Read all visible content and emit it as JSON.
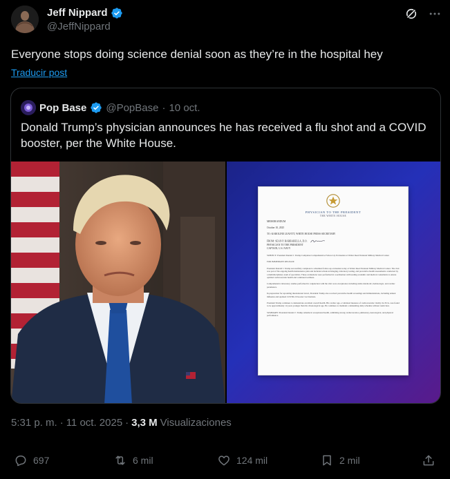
{
  "author": {
    "name": "Jeff Nippard",
    "handle": "@JeffNippard"
  },
  "tweet": {
    "text": "Everyone stops doing science denial soon as they’re in the hospital hey",
    "translate_label": "Traducir post"
  },
  "quoted": {
    "name": "Pop Base",
    "handle": "@PopBase",
    "separator": "·",
    "date": "10 oct.",
    "text": "Donald Trump’s physician announces he has received a flu shot and a COVID booster, per the White House.",
    "document": {
      "title": "PHYSICIAN TO THE PRESIDENT",
      "subtitle": "THE WHITE HOUSE",
      "memo": "MEMORANDUM",
      "date": "October 10, 2025",
      "to": "TO: KAROLINE LEAVITT, WHITE HOUSE PRESS SECRETARY",
      "from_1": "FROM: SEAN P. BARBABELLA, D.O.",
      "from_2": "PHYSICIAN TO THE PRESIDENT",
      "from_3": "CAPTAIN, U.S. NAVY",
      "subject": "SUBJECT: President Donald J. Trump Completes Comprehensive Follow-Up Evaluation at Walter Reed National Military Medical Center",
      "release": "FOR IMMEDIATE RELEASE",
      "para_1": "President Donald J. Trump successfully completed a scheduled follow-up evaluation today at Walter Reed National Military Medical Center. The visit was part of his ongoing health maintenance plan and included advanced imaging, laboratory testing, and preventive health assessments conducted by a multidisciplinary team of specialists. These evaluations were performed in coordination with leading academic and medical consultants to ensure optimal cardiovascular health and continued wellness.",
      "para_2": "Comprehensive laboratory studies performed in conjunction with the visit were exceptional, including stable metabolic, hematologic, and cardiac parameters.",
      "para_3": "In preparation for upcoming international travel, President Trump also received preventive health screenings and immunizations, including annual influenza and updated COVID-19 booster vaccinations.",
      "para_4": "President Trump continues to demonstrate excellent overall health. His cardiac age–a validated measure of cardiovascular vitality via ECG–was found to be approximately 14 years younger than his chronological age. He continues to maintain a demanding daily schedule without restriction.",
      "summary": "SUMMARY: President Donald J. Trump remains in exceptional health, exhibiting strong cardiovascular, pulmonary, neurological, and physical performance."
    }
  },
  "meta": {
    "time": "5:31 p. m.",
    "separator": "·",
    "date": "11 oct. 2025",
    "separator_2": "·",
    "views_count": "3,3 M",
    "views_label": "Visualizaciones"
  },
  "actions": {
    "replies": "697",
    "reposts": "6 mil",
    "likes": "124 mil",
    "bookmarks": "2 mil"
  },
  "colors": {
    "background": "#000000",
    "text": "#e7e9ea",
    "muted": "#71767b",
    "link": "#1d9bf0",
    "border": "#2f3336",
    "verified": "#1d9bf0"
  }
}
